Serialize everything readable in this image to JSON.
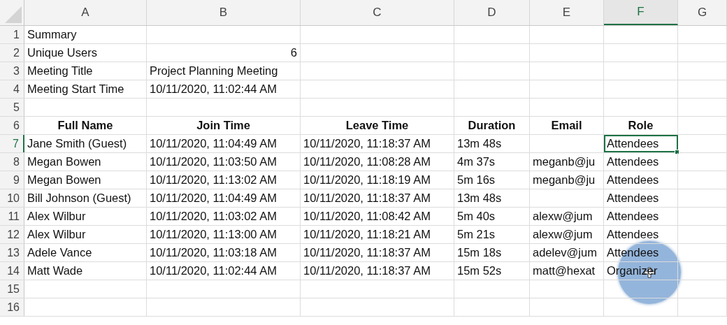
{
  "columns": [
    {
      "label": "A",
      "selected": false
    },
    {
      "label": "B",
      "selected": false
    },
    {
      "label": "C",
      "selected": false
    },
    {
      "label": "D",
      "selected": false
    },
    {
      "label": "E",
      "selected": false
    },
    {
      "label": "F",
      "selected": true
    },
    {
      "label": "G",
      "selected": false
    }
  ],
  "rows": [
    {
      "number": "1",
      "kind": "summary",
      "selected": false,
      "cells": [
        "Summary"
      ]
    },
    {
      "number": "2",
      "kind": "summary",
      "selected": false,
      "numeric": true,
      "cells": [
        "Unique Users",
        "6"
      ]
    },
    {
      "number": "3",
      "kind": "summary",
      "selected": false,
      "cells": [
        "Meeting Title",
        "Project Planning Meeting"
      ]
    },
    {
      "number": "4",
      "kind": "summary",
      "selected": false,
      "cells": [
        "Meeting Start Time",
        "10/11/2020, 11:02:44 AM"
      ]
    },
    {
      "number": "5",
      "kind": "empty",
      "selected": false
    },
    {
      "number": "6",
      "kind": "header",
      "selected": false,
      "cells": [
        "Full Name",
        "Join Time",
        "Leave Time",
        "Duration",
        "Email",
        "Role"
      ]
    },
    {
      "number": "7",
      "kind": "data",
      "selected": true,
      "cells": [
        "Jane Smith (Guest)",
        "10/11/2020, 11:04:49 AM",
        "10/11/2020, 11:18:37 AM",
        "13m 48s",
        "",
        "Attendees"
      ]
    },
    {
      "number": "8",
      "kind": "data",
      "selected": false,
      "cells": [
        "Megan Bowen",
        "10/11/2020, 11:03:50 AM",
        "10/11/2020, 11:08:28 AM",
        "4m 37s",
        "meganb@ju",
        "Attendees"
      ]
    },
    {
      "number": "9",
      "kind": "data",
      "selected": false,
      "cells": [
        "Megan Bowen",
        "10/11/2020, 11:13:02 AM",
        "10/11/2020, 11:18:19 AM",
        "5m 16s",
        "meganb@ju",
        "Attendees"
      ]
    },
    {
      "number": "10",
      "kind": "data",
      "selected": false,
      "cells": [
        "Bill Johnson (Guest)",
        "10/11/2020, 11:04:49 AM",
        "10/11/2020, 11:18:37 AM",
        "13m 48s",
        "",
        "Attendees"
      ]
    },
    {
      "number": "11",
      "kind": "data",
      "selected": false,
      "cells": [
        "Alex Wilbur",
        "10/11/2020, 11:03:02 AM",
        "10/11/2020, 11:08:42 AM",
        "5m 40s",
        "alexw@jum",
        "Attendees"
      ]
    },
    {
      "number": "12",
      "kind": "data",
      "selected": false,
      "cells": [
        "Alex Wilbur",
        "10/11/2020, 11:13:00 AM",
        "10/11/2020, 11:18:21 AM",
        "5m 21s",
        "alexw@jum",
        "Attendees"
      ]
    },
    {
      "number": "13",
      "kind": "data",
      "selected": false,
      "cells": [
        "Adele Vance",
        "10/11/2020, 11:03:18 AM",
        "10/11/2020, 11:18:37 AM",
        "15m 18s",
        "adelev@jum",
        "Attendees"
      ]
    },
    {
      "number": "14",
      "kind": "data",
      "selected": false,
      "cells": [
        "Matt Wade",
        "10/11/2020, 11:02:44 AM",
        "10/11/2020, 11:18:37 AM",
        "15m 52s",
        "matt@hexat",
        "Organizer"
      ]
    },
    {
      "number": "15",
      "kind": "empty",
      "selected": false
    },
    {
      "number": "16",
      "kind": "empty",
      "selected": false
    }
  ]
}
